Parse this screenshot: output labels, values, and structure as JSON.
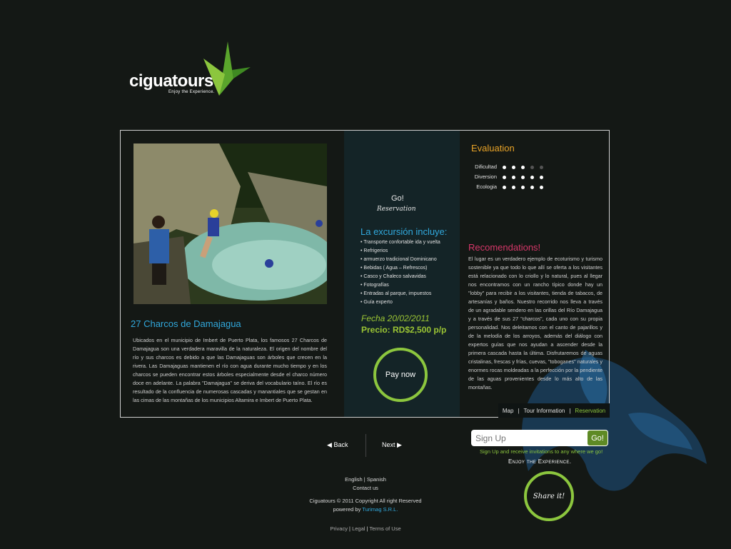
{
  "brand": {
    "name": "ciguatours",
    "registered": "®",
    "tagline": "Enjoy the Experience."
  },
  "tour": {
    "title": "27 Charcos de Damajagua",
    "description": "Ubicados en el municipio de Imbert de Puerto Plata, los famosos 27 Charcos de Damajagua son una verdadera maravilla de la naturaleza. El origen del nombre del río y sus charcos es debido a que las Damajaguas son árboles que crecen en la rivera. Las Damajaguas mantienen el río con agua durante mucho tiempo y en los charcos se pueden encontrar estos árboles especialmente desde el charco número doce en adelante. La palabra \"Damajagua\" se deriva del vocabulario taíno. El río es resultado de la confluencia de numerosas cascadas y manantiales que se gestan en las cimas de las montañas de los municipios Altamira e Imbert de Puerto Plata."
  },
  "booking": {
    "go_label": "Go!",
    "reservation_label": "Reservation",
    "includes_title": "La excursión incluye:",
    "includes": [
      "• Transporte confortable ida y vuelta",
      "• Refrigerios",
      "• armuerzo tradicional Dominicano",
      "• Bebidas ( Agua – Refrescos)",
      "• Casco y Chaleco salvavidas",
      "• Fotografías",
      "• Entradas al parque, impuestos",
      "• Guía experto"
    ],
    "fecha": "Fecha 20/02/2011",
    "precio": "Precio: RD$2,500 p/p",
    "pay_now": "Pay now"
  },
  "evaluation": {
    "title": "Evaluation",
    "rows": [
      {
        "label": "Dificultad",
        "score": 3,
        "max": 5
      },
      {
        "label": "Diversion",
        "score": 5,
        "max": 5
      },
      {
        "label": "Ecologia",
        "score": 5,
        "max": 5
      }
    ]
  },
  "recommendations": {
    "title": "Recomendations!",
    "text": "El lugar es un verdadero ejemplo de ecoturismo y turismo sostenible ya que todo lo que allí se oferta a los visitantes está relacionado con lo criollo y lo natural, pues al llegar nos encontramos con un rancho típico donde hay un \"lobby\" para recibir a los visitantes, tienda de tabacos, de artesanías y baños. Nuestro recorrido nos lleva a través de un agradable sendero en las orillas del Río Damajagua y a través de sus 27 \"charcos\", cada uno con su propia personalidad. Nos deleitamos con el canto de pajarillos y de la melodía de los arroyos, además del diálogo con expertos guías que nos ayudan a ascender desde la primera cascada hasta la última. Disfrutaremos de aguas cristalinas, frescas y frías, cuevas, \"toboganes\" naturales y enormes rocas moldeadas a la perfección por la pendiente de las aguas provenientes desde lo más alto de las montañas."
  },
  "tabs": {
    "map": "Map",
    "tour_info": "Tour Information",
    "reservation": "Reservation",
    "sep": "|"
  },
  "nav": {
    "back": "Back",
    "next": "Next"
  },
  "signup": {
    "placeholder": "Sign Up",
    "go": "Go!",
    "caption": "Sign Up and receive invitations to any where we go!",
    "enjoy": "Enjoy the Experience."
  },
  "share": {
    "label": "Share it!"
  },
  "footer": {
    "english": "English",
    "spanish": "Spanish",
    "contact": "Contact us",
    "copyright": "Ciguatours  © 2011 Copyright All right Reserved",
    "powered_prefix": "powered by ",
    "powered_name": "Turimag S.R.L.",
    "privacy": "Privacy",
    "legal": "Legal",
    "terms": "Terms of Use",
    "sep": "|"
  },
  "colors": {
    "background": "#141815",
    "accent_green": "#8cc63e",
    "accent_blue": "#31a9dd",
    "accent_orange": "#e7a227",
    "accent_pink": "#d63769",
    "panel": "#142427"
  },
  "icons": {
    "back": "triangle-left-icon",
    "next": "triangle-right-icon",
    "logo": "bird-logo-icon"
  }
}
